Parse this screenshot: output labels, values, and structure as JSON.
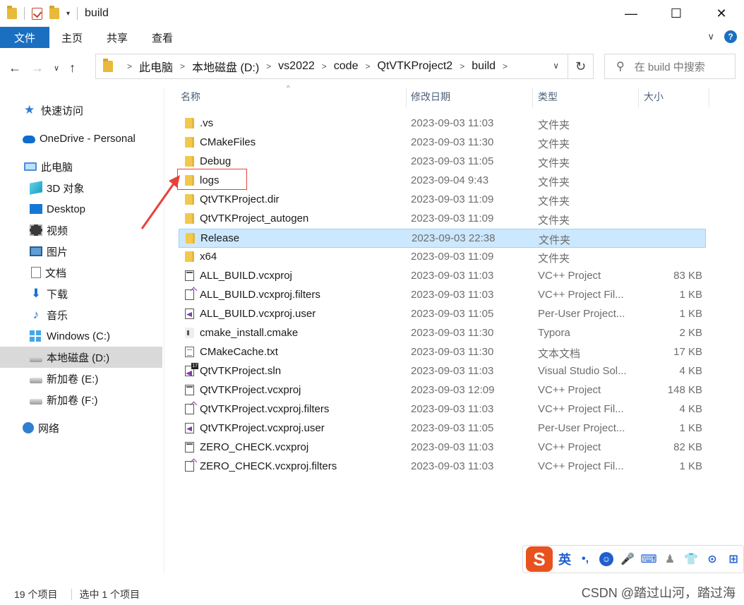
{
  "window": {
    "title": "build",
    "minimize": "—",
    "maximize": "☐",
    "close": "✕"
  },
  "ribbon": {
    "tabs": [
      "文件",
      "主页",
      "共享",
      "查看"
    ],
    "expand_icon": "chevron-down-icon",
    "help_label": "?"
  },
  "nav": {
    "back": "←",
    "forward": "→",
    "recent": "∨",
    "up": "↑"
  },
  "address": {
    "crumbs": [
      "此电脑",
      "本地磁盘 (D:)",
      "vs2022",
      "code",
      "QtVTKProject2",
      "build"
    ],
    "separator": ">",
    "dropdown": "∨",
    "refresh": "↻"
  },
  "search": {
    "placeholder": "在 build 中搜索"
  },
  "sidebar": {
    "items": [
      {
        "label": "快速访问",
        "icon": "star-icon"
      },
      {
        "label": "OneDrive - Personal",
        "icon": "cloud-icon"
      },
      {
        "label": "此电脑",
        "icon": "computer-icon"
      },
      {
        "label": "3D 对象",
        "icon": "cube-icon"
      },
      {
        "label": "Desktop",
        "icon": "desktop-icon"
      },
      {
        "label": "视频",
        "icon": "video-icon"
      },
      {
        "label": "图片",
        "icon": "pictures-icon"
      },
      {
        "label": "文档",
        "icon": "document-icon"
      },
      {
        "label": "下载",
        "icon": "download-icon"
      },
      {
        "label": "音乐",
        "icon": "music-icon"
      },
      {
        "label": "Windows (C:)",
        "icon": "windows-drive-icon"
      },
      {
        "label": "本地磁盘 (D:)",
        "icon": "drive-icon"
      },
      {
        "label": "新加卷 (E:)",
        "icon": "drive-icon"
      },
      {
        "label": "新加卷 (F:)",
        "icon": "drive-icon"
      },
      {
        "label": "网络",
        "icon": "network-icon"
      }
    ]
  },
  "columns": {
    "name": "名称",
    "date": "修改日期",
    "type": "类型",
    "size": "大小",
    "sort_indicator": "^"
  },
  "files": [
    {
      "name": ".vs",
      "date": "2023-09-03 11:03",
      "type": "文件夹",
      "size": "",
      "icon": "folder-icon"
    },
    {
      "name": "CMakeFiles",
      "date": "2023-09-03 11:30",
      "type": "文件夹",
      "size": "",
      "icon": "folder-icon"
    },
    {
      "name": "Debug",
      "date": "2023-09-03 11:05",
      "type": "文件夹",
      "size": "",
      "icon": "folder-icon"
    },
    {
      "name": "logs",
      "date": "2023-09-04 9:43",
      "type": "文件夹",
      "size": "",
      "icon": "folder-icon"
    },
    {
      "name": "QtVTKProject.dir",
      "date": "2023-09-03 11:09",
      "type": "文件夹",
      "size": "",
      "icon": "folder-icon"
    },
    {
      "name": "QtVTKProject_autogen",
      "date": "2023-09-03 11:09",
      "type": "文件夹",
      "size": "",
      "icon": "folder-icon"
    },
    {
      "name": "Release",
      "date": "2023-09-03 22:38",
      "type": "文件夹",
      "size": "",
      "icon": "folder-icon"
    },
    {
      "name": "x64",
      "date": "2023-09-03 11:09",
      "type": "文件夹",
      "size": "",
      "icon": "folder-icon"
    },
    {
      "name": "ALL_BUILD.vcxproj",
      "date": "2023-09-03 11:03",
      "type": "VC++ Project",
      "size": "83 KB",
      "icon": "vcxproj-icon"
    },
    {
      "name": "ALL_BUILD.vcxproj.filters",
      "date": "2023-09-03 11:03",
      "type": "VC++ Project Fil...",
      "size": "1 KB",
      "icon": "filters-icon"
    },
    {
      "name": "ALL_BUILD.vcxproj.user",
      "date": "2023-09-03 11:05",
      "type": "Per-User Project...",
      "size": "1 KB",
      "icon": "user-project-icon"
    },
    {
      "name": "cmake_install.cmake",
      "date": "2023-09-03 11:30",
      "type": "Typora",
      "size": "2 KB",
      "icon": "cmake-file-icon"
    },
    {
      "name": "CMakeCache.txt",
      "date": "2023-09-03 11:30",
      "type": "文本文档",
      "size": "17 KB",
      "icon": "text-file-icon"
    },
    {
      "name": "QtVTKProject.sln",
      "date": "2023-09-03 11:03",
      "type": "Visual Studio Sol...",
      "size": "4 KB",
      "icon": "solution-icon"
    },
    {
      "name": "QtVTKProject.vcxproj",
      "date": "2023-09-03 12:09",
      "type": "VC++ Project",
      "size": "148 KB",
      "icon": "vcxproj-icon"
    },
    {
      "name": "QtVTKProject.vcxproj.filters",
      "date": "2023-09-03 11:03",
      "type": "VC++ Project Fil...",
      "size": "4 KB",
      "icon": "filters-icon"
    },
    {
      "name": "QtVTKProject.vcxproj.user",
      "date": "2023-09-03 11:05",
      "type": "Per-User Project...",
      "size": "1 KB",
      "icon": "user-project-icon"
    },
    {
      "name": "ZERO_CHECK.vcxproj",
      "date": "2023-09-03 11:03",
      "type": "VC++ Project",
      "size": "82 KB",
      "icon": "vcxproj-icon"
    },
    {
      "name": "ZERO_CHECK.vcxproj.filters",
      "date": "2023-09-03 11:03",
      "type": "VC++ Project Fil...",
      "size": "1 KB",
      "icon": "filters-icon"
    }
  ],
  "selected_file": "Release",
  "annotation": {
    "highlight_color": "#e8413a"
  },
  "status": {
    "count": "19 个项目",
    "selected": "选中 1 个项目"
  },
  "ime": {
    "logo": "S",
    "mode": "英",
    "punct": "•,",
    "tools": [
      "emoji-icon",
      "microphone-icon",
      "keyboard-icon",
      "user-icon",
      "skin-icon",
      "gamepad-icon",
      "grid-icon"
    ]
  },
  "watermark": "CSDN @踏过山河，踏过海",
  "colors": {
    "accent": "#1a6fc1",
    "selection_bg": "#cce8ff",
    "folder": "#f2c94c"
  }
}
